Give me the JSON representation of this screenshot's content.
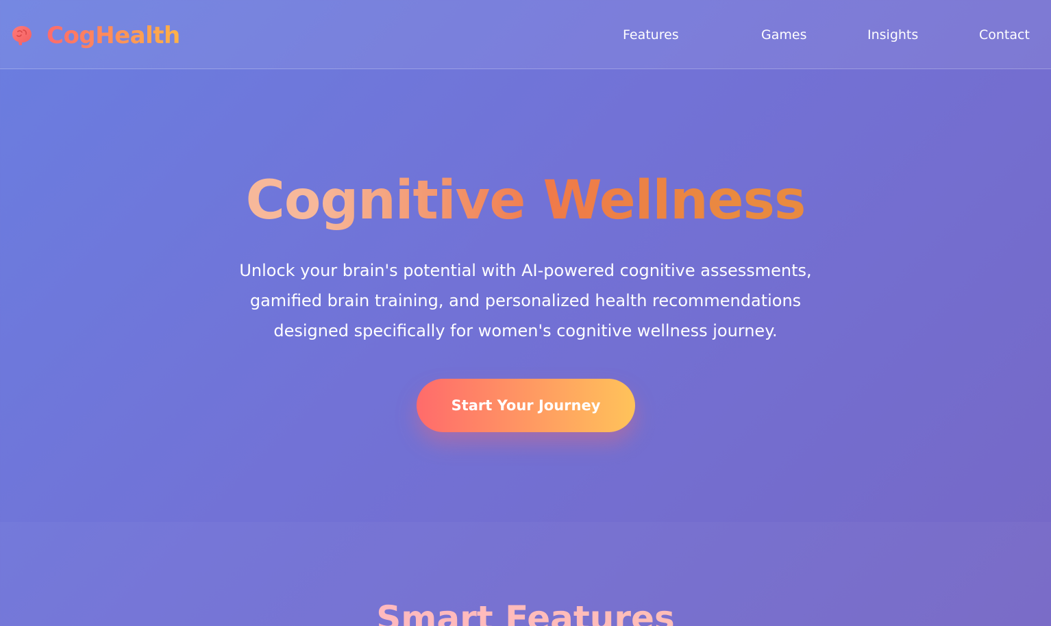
{
  "header": {
    "logo_icon": "brain-icon",
    "brand": "CogHealth",
    "nav": [
      {
        "label": "Features"
      },
      {
        "label": "Games"
      },
      {
        "label": "Insights"
      },
      {
        "label": "Contact"
      }
    ]
  },
  "hero": {
    "title": "Cognitive Wellness",
    "subtitle": "Unlock your brain's potential with AI-powered cognitive assessments, gamified brain training, and personalized health recommendations designed specifically for women's cognitive wellness journey.",
    "cta_label": "Start Your Journey"
  },
  "features": {
    "title": "Smart Features"
  },
  "colors": {
    "accent_start": "#ff6b6b",
    "accent_end": "#ffc35a",
    "background": "#7272d6"
  }
}
